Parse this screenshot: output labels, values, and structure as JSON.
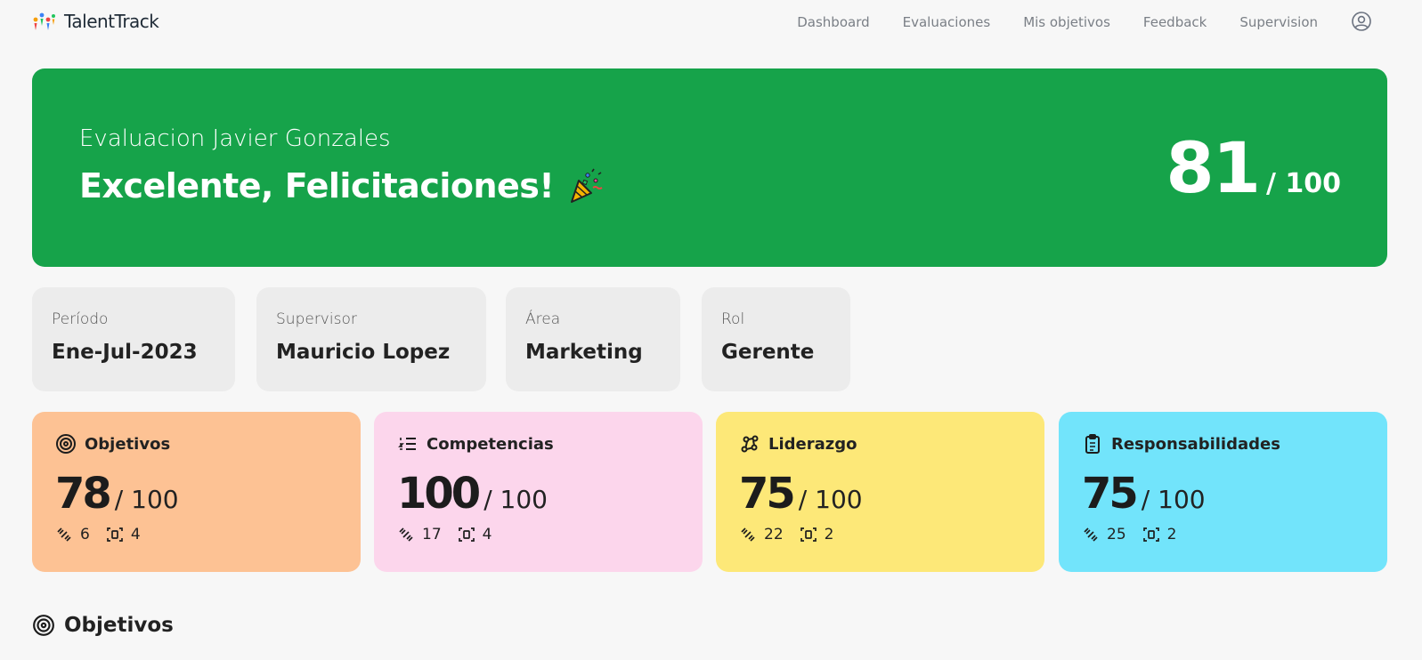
{
  "app": {
    "name": "TalentTrack"
  },
  "nav": {
    "items": [
      "Dashboard",
      "Evaluaciones",
      "Mis objetivos",
      "Feedback",
      "Supervision"
    ]
  },
  "hero": {
    "subtitle": "Evaluacion Javier Gonzales",
    "title": "Excelente, Felicitaciones!",
    "score": "81",
    "score_max": "/ 100",
    "bg_color": "#16a34a"
  },
  "info": [
    {
      "label": "Período",
      "value": "Ene-Jul-2023"
    },
    {
      "label": "Supervisor",
      "value": "Mauricio Lopez"
    },
    {
      "label": "Área",
      "value": "Marketing"
    },
    {
      "label": "Rol",
      "value": "Gerente"
    }
  ],
  "categories": [
    {
      "title": "Objetivos",
      "icon": "target-icon",
      "score": "78",
      "max": "/ 100",
      "count_a": "6",
      "count_b": "4",
      "color": "#fdc294"
    },
    {
      "title": "Competencias",
      "icon": "list-icon",
      "score": "100",
      "max": "/ 100",
      "count_a": "17",
      "count_b": "4",
      "color": "#fcd6ec"
    },
    {
      "title": "Liderazgo",
      "icon": "network-icon",
      "score": "75",
      "max": "/ 100",
      "count_a": "22",
      "count_b": "2",
      "color": "#fde878"
    },
    {
      "title": "Responsabilidades",
      "icon": "clipboard-icon",
      "score": "75",
      "max": "/ 100",
      "count_a": "25",
      "count_b": "2",
      "color": "#72e4fb"
    }
  ],
  "section": {
    "title": "Objetivos",
    "icon": "target-icon"
  }
}
